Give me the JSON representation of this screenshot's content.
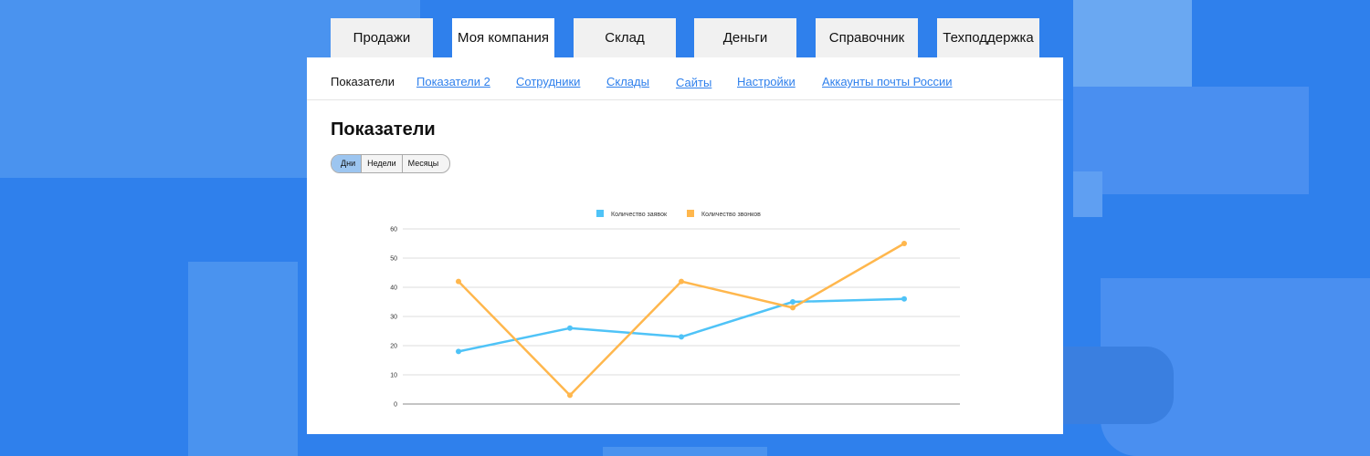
{
  "tabs": [
    {
      "label": "Продажи"
    },
    {
      "label": "Моя компания"
    },
    {
      "label": "Склад"
    },
    {
      "label": "Деньги"
    },
    {
      "label": "Справочник"
    },
    {
      "label": "Техподдержка"
    }
  ],
  "active_tab": 1,
  "subnav": [
    {
      "label": "Показатели"
    },
    {
      "label": "Показатели 2"
    },
    {
      "label": "Сотрудники"
    },
    {
      "label": "Склады"
    },
    {
      "label": "Сайты"
    },
    {
      "label": "Настройки"
    },
    {
      "label": "Аккаунты почты России"
    }
  ],
  "page_title": "Показатели",
  "period_options": [
    {
      "label": "Дни"
    },
    {
      "label": "Недели"
    },
    {
      "label": "Месяцы"
    }
  ],
  "selected_period": "Дни",
  "colors": {
    "background": "#2f80ec",
    "link": "#2f80ec",
    "series_requests": "#4fc3f7",
    "series_calls": "#ffb74d"
  },
  "chart_data": {
    "type": "line",
    "ylim": [
      0,
      60
    ],
    "yticks": [
      0,
      10,
      20,
      30,
      40,
      50,
      60
    ],
    "grid": true,
    "legend": "top-center",
    "x": [
      1,
      2,
      3,
      4,
      5
    ],
    "series": [
      {
        "name": "Количество заявок",
        "color": "#4fc3f7",
        "values": [
          18,
          26,
          23,
          35,
          36
        ]
      },
      {
        "name": "Количество звонков",
        "color": "#ffb74d",
        "values": [
          42,
          3,
          42,
          33,
          55
        ]
      }
    ]
  }
}
